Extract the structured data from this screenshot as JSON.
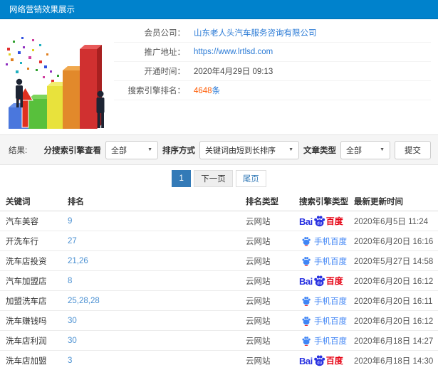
{
  "header": {
    "title": "网络营销效果展示"
  },
  "info": {
    "member_label": "会员公司：",
    "member_value": "山东老人头汽车服务咨询有限公司",
    "url_label": "推广地址：",
    "url_value": "https://www.lrtlsd.com",
    "open_label": "开通时间：",
    "open_value": "2020年4月29日 09:13",
    "rank_label": "搜索引擎排名：",
    "rank_count": "4648",
    "rank_unit": "条"
  },
  "filters": {
    "result_label": "结果:",
    "engine_label": "分搜索引擎查看",
    "engine_value": "全部",
    "sort_label": "排序方式",
    "sort_value": "关键词由短到长排序",
    "article_label": "文章类型",
    "article_value": "全部",
    "submit_label": "提交"
  },
  "pagination": {
    "current": "1",
    "next": "下一页",
    "last": "尾页"
  },
  "table": {
    "headers": [
      "关键词",
      "排名",
      "排名类型",
      "搜索引擎类型",
      "最新更新时间"
    ],
    "rows": [
      {
        "keyword": "汽车美容",
        "rank": "9",
        "rank_type": "云网站",
        "engine": "baidu",
        "updated": "2020年6月5日 11:24"
      },
      {
        "keyword": "开洗车行",
        "rank": "27",
        "rank_type": "云网站",
        "engine": "mobile-baidu",
        "updated": "2020年6月20日 16:16"
      },
      {
        "keyword": "洗车店投资",
        "rank": "21,26",
        "rank_type": "云网站",
        "engine": "mobile-baidu",
        "updated": "2020年5月27日 14:58"
      },
      {
        "keyword": "汽车加盟店",
        "rank": "8",
        "rank_type": "云网站",
        "engine": "baidu",
        "updated": "2020年6月20日 16:12"
      },
      {
        "keyword": "加盟洗车店",
        "rank": "25,28,28",
        "rank_type": "云网站",
        "engine": "mobile-baidu",
        "updated": "2020年6月20日 16:11"
      },
      {
        "keyword": "洗车赚钱吗",
        "rank": "30",
        "rank_type": "云网站",
        "engine": "mobile-baidu",
        "updated": "2020年6月20日 16:12"
      },
      {
        "keyword": "洗车店利润",
        "rank": "30",
        "rank_type": "云网站",
        "engine": "mobile-baidu",
        "updated": "2020年6月18日 14:27"
      },
      {
        "keyword": "洗车店加盟",
        "rank": "3",
        "rank_type": "云网站",
        "engine": "baidu",
        "updated": "2020年6月18日 14:30"
      }
    ]
  },
  "engine_labels": {
    "baidu_bai": "Bai",
    "baidu_du": "du",
    "baidu_cn": "百度",
    "mobile_baidu": "手机百度"
  },
  "colors": {
    "header_bg": "#0082cc",
    "link_blue": "#2b7bd6",
    "rank_blue": "#4a90d2",
    "highlight_orange": "#ff5a00",
    "pagination_active": "#337ab7",
    "baidu_blue": "#2932e1",
    "baidu_red": "#e60012",
    "mobile_baidu_blue": "#4085f5"
  }
}
